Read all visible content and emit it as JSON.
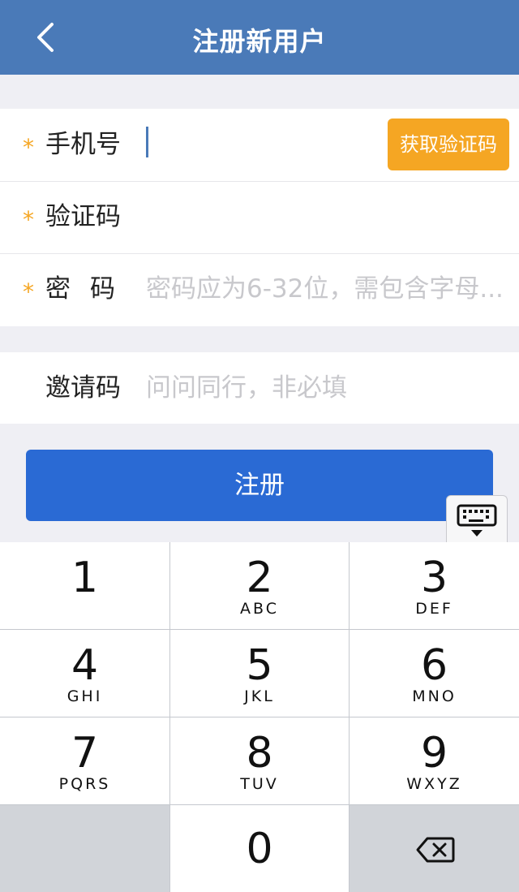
{
  "nav": {
    "title": "注册新用户",
    "back_icon": "chevron-left-icon",
    "color": "#4a7ab8"
  },
  "form": {
    "phone": {
      "required_mark": "*",
      "label": "手机号",
      "value": "",
      "code_button": "获取验证码"
    },
    "code": {
      "required_mark": "*",
      "label": "验证码",
      "value": ""
    },
    "password": {
      "required_mark": "*",
      "label": "密码",
      "placeholder": "密码应为6-32位，需包含字母..."
    },
    "invite": {
      "label": "邀请码",
      "placeholder": "问问同行，非必填"
    }
  },
  "submit_label": "注册",
  "keyboard": {
    "toggle_icon": "keyboard-dismiss-icon",
    "keys": [
      {
        "num": "1",
        "letters": ""
      },
      {
        "num": "2",
        "letters": "ABC"
      },
      {
        "num": "3",
        "letters": "DEF"
      },
      {
        "num": "4",
        "letters": "GHI"
      },
      {
        "num": "5",
        "letters": "JKL"
      },
      {
        "num": "6",
        "letters": "MNO"
      },
      {
        "num": "7",
        "letters": "PQRS"
      },
      {
        "num": "8",
        "letters": "TUV"
      },
      {
        "num": "9",
        "letters": "WXYZ"
      }
    ],
    "zero": "0",
    "delete_icon": "backspace-icon"
  },
  "colors": {
    "accent_orange": "#f5a623",
    "primary_blue": "#2a6ad4"
  }
}
